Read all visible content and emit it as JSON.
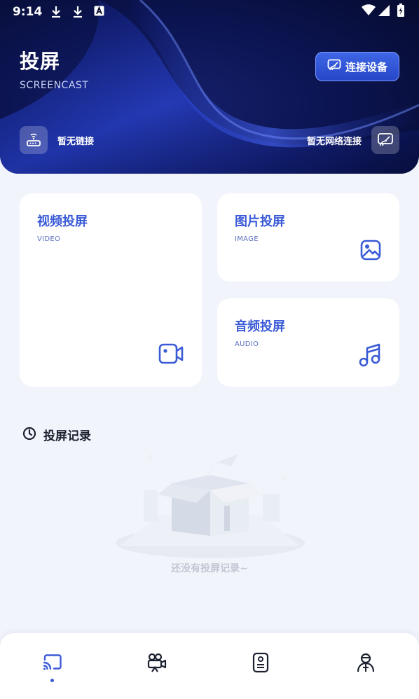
{
  "status_bar": {
    "time": "9:14"
  },
  "header": {
    "title": "投屏",
    "subtitle": "SCREENCAST",
    "connect_button": "连接设备",
    "left_status": "暂无链接",
    "right_status": "暂无网络连接"
  },
  "cards": {
    "video": {
      "title": "视频投屏",
      "subtitle": "VIDEO"
    },
    "image": {
      "title": "图片投屏",
      "subtitle": "IMAGE"
    },
    "audio": {
      "title": "音频投屏",
      "subtitle": "AUDIO"
    }
  },
  "history": {
    "title": "投屏记录",
    "empty_text": "还没有投屏记录~"
  },
  "tabs": [
    {
      "icon": "cast-icon",
      "active": true
    },
    {
      "icon": "camera-icon",
      "active": false
    },
    {
      "icon": "file-icon",
      "active": false
    },
    {
      "icon": "profile-icon",
      "active": false
    }
  ],
  "colors": {
    "accent": "#3a5bd6",
    "background": "#f1f4fb",
    "hero_dark": "#050a2a"
  }
}
